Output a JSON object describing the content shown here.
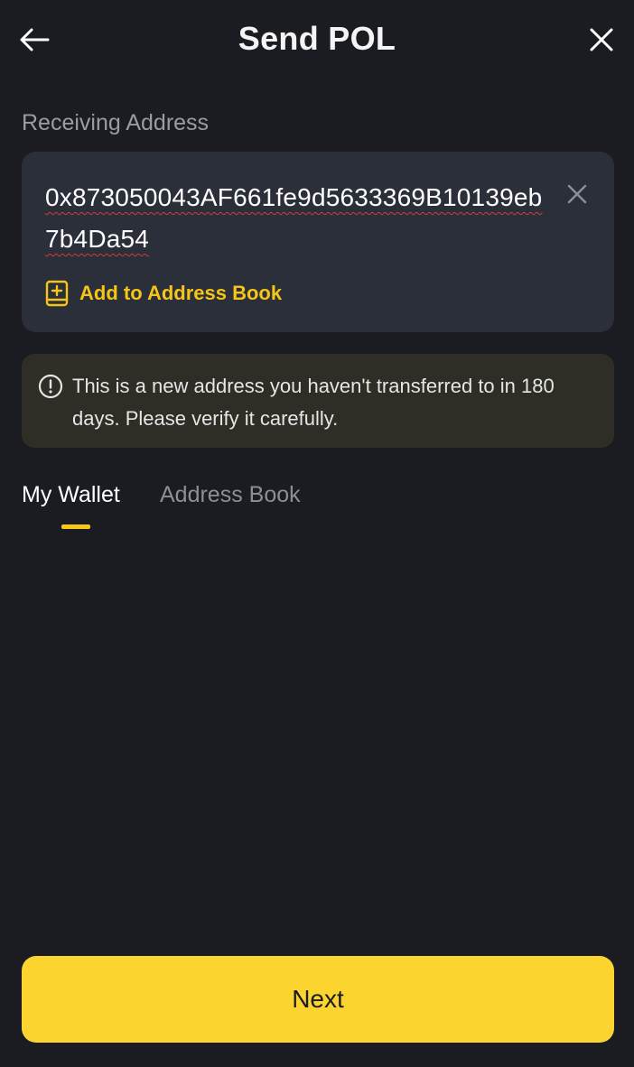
{
  "header": {
    "title": "Send POL",
    "back_icon": "arrow-left-icon",
    "close_icon": "close-icon"
  },
  "receiving": {
    "label": "Receiving Address",
    "address": "0x873050043AF661fe9d5633369B10139eb7b4Da54",
    "add_to_book_label": "Add to Address Book"
  },
  "warning": {
    "text": "This is a new address you haven't transferred to in 180 days. Please verify it carefully."
  },
  "tabs": [
    {
      "label": "My Wallet",
      "active": true
    },
    {
      "label": "Address Book",
      "active": false
    }
  ],
  "footer": {
    "next_label": "Next"
  },
  "colors": {
    "background": "#1b1c21",
    "card": "#2a2f3a",
    "warning_bg": "#2e2d26",
    "accent": "#f5c518",
    "button": "#fbd42f"
  }
}
